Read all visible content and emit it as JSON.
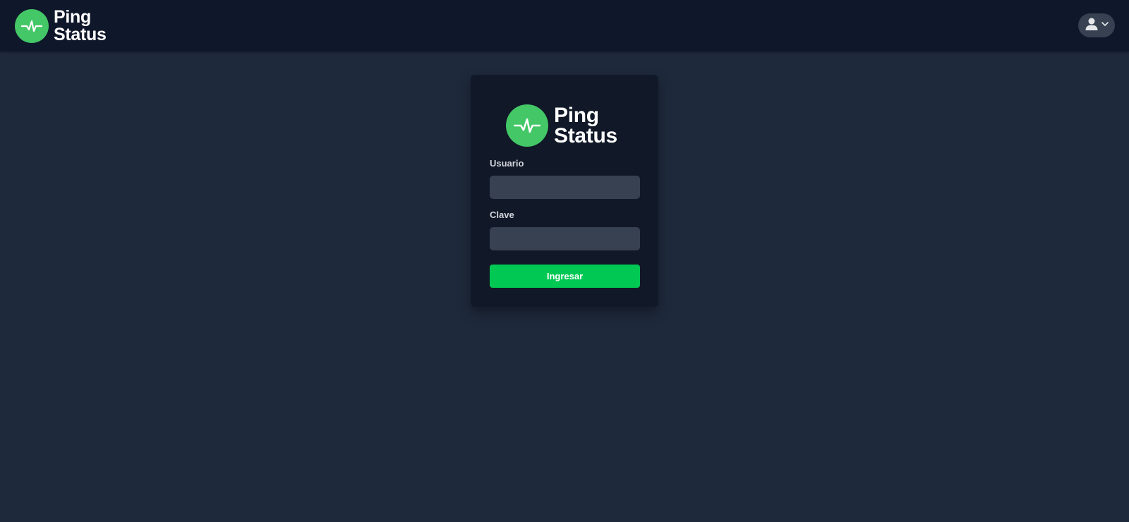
{
  "navbar": {
    "logo": {
      "line1": "Ping",
      "line2": "Status",
      "icon": "pulse-icon"
    },
    "user_menu": {
      "icon": "user-icon",
      "caret": "chevron-down-icon"
    }
  },
  "login": {
    "logo": {
      "line1": "Ping",
      "line2": "Status",
      "icon": "pulse-icon"
    },
    "username_label": "Usuario",
    "username_value": "",
    "password_label": "Clave",
    "password_value": "",
    "submit_label": "Ingresar"
  },
  "colors": {
    "page_bg": "#1e293b",
    "navbar_bg": "#0f172a",
    "card_bg": "#111827",
    "input_bg": "#374151",
    "logo_green": "#44c767",
    "button_green": "#00c853"
  }
}
